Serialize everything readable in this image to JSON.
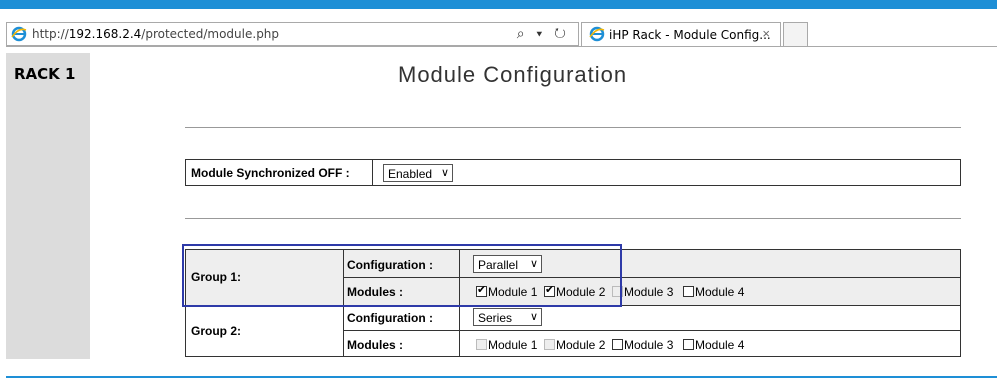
{
  "browser": {
    "url_prefix": "http://",
    "url_host": "192.168.2.4",
    "url_path": "/protected/module.php",
    "addr_controls": "⌕ ▾ ↻",
    "tab_title": "iHP Rack - Module Config...",
    "tab_close": "×"
  },
  "sidebar": {
    "rack_label": "RACK 1"
  },
  "page": {
    "title": "Module Configuration"
  },
  "sync": {
    "label": "Module Synchronized OFF :",
    "value": "Enabled",
    "arrow": "∨"
  },
  "groups": [
    {
      "name": "Group 1:",
      "config_label": "Configuration :",
      "config_value": "Parallel",
      "modules_label": "Modules :",
      "modules": [
        {
          "label": "Module 1",
          "checked": true,
          "disabled": false
        },
        {
          "label": "Module 2",
          "checked": true,
          "disabled": false
        },
        {
          "label": "Module 3",
          "checked": false,
          "disabled": true
        },
        {
          "label": "Module 4",
          "checked": false,
          "disabled": false
        }
      ]
    },
    {
      "name": "Group 2:",
      "config_label": "Configuration :",
      "config_value": "Series",
      "modules_label": "Modules :",
      "modules": [
        {
          "label": "Module 1",
          "checked": false,
          "disabled": true
        },
        {
          "label": "Module 2",
          "checked": false,
          "disabled": true
        },
        {
          "label": "Module 3",
          "checked": false,
          "disabled": false
        },
        {
          "label": "Module 4",
          "checked": false,
          "disabled": false
        }
      ]
    }
  ],
  "colors": {
    "accent": "#1e8fd6",
    "highlight": "#2e3aa8",
    "sidebar": "#dcdcdc"
  }
}
